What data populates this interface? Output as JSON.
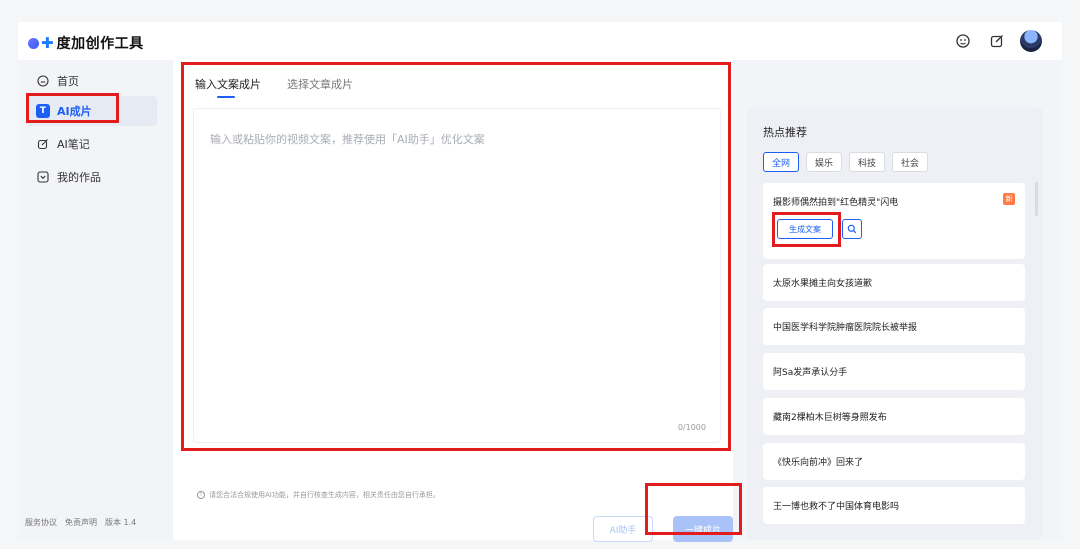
{
  "app": {
    "title": "度加创作工具"
  },
  "sidebar": {
    "items": [
      {
        "label": "首页",
        "icon": "home-icon"
      },
      {
        "label": "AI成片",
        "icon": "ai-video-icon",
        "active": true
      },
      {
        "label": "AI笔记",
        "icon": "pen-note-icon"
      },
      {
        "label": "我的作品",
        "icon": "works-icon"
      }
    ],
    "footer": [
      "服务协议",
      "免责声明",
      "版本 1.4"
    ]
  },
  "main": {
    "tabs": [
      {
        "label": "输入文案成片",
        "active": true
      },
      {
        "label": "选择文章成片",
        "active": false
      }
    ],
    "textarea_placeholder": "输入或粘贴你的视频文案，推荐使用「AI助手」优化文案",
    "char_count": "0/1000",
    "notice": "请您合法合规使用AI功能，并自行核查生成内容，相关责任由您自行承担。",
    "ai_assistant_label": "AI助手",
    "one_click_label": "一键成片"
  },
  "hot": {
    "title": "热点推荐",
    "filters": [
      {
        "label": "全网",
        "active": true
      },
      {
        "label": "娱乐",
        "active": false
      },
      {
        "label": "科技",
        "active": false
      },
      {
        "label": "社会",
        "active": false
      }
    ],
    "items": [
      "摄影师偶然拍到\"红色精灵\"闪电",
      "太原水果摊主向女孩道歉",
      "中国医学科学院肿瘤医院院长被举报",
      "阿Sa发声承认分手",
      "藏南2棵柏木巨树等身照发布",
      "《快乐向前冲》回来了",
      "王一博也救不了中国体育电影吗"
    ],
    "new_badge": "新",
    "generate_label": "生成文案"
  },
  "colors": {
    "accent": "#1d5ff5",
    "annotation": "#e01c1c",
    "new_badge": "#ff7a45"
  }
}
